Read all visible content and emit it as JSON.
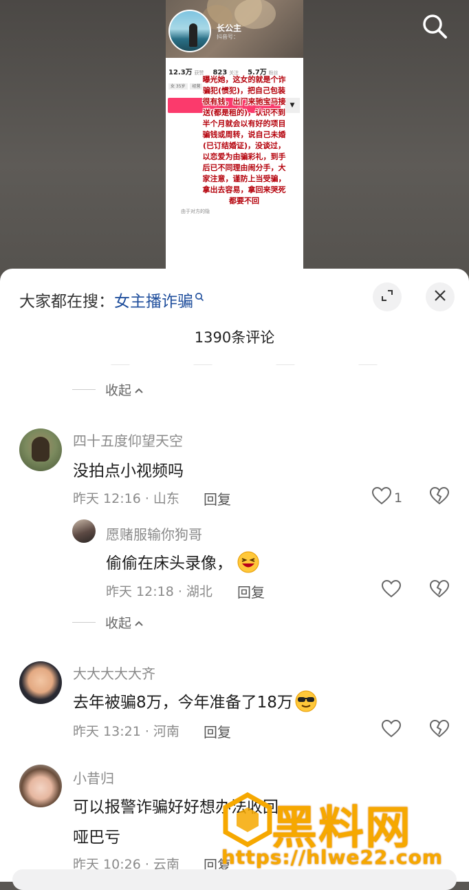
{
  "video": {
    "poster": {
      "name": "长公主",
      "subtitle": "抖音号：",
      "stats": [
        {
          "value": "12.3万",
          "label": "获赞"
        },
        {
          "value": "823",
          "label": "关注"
        },
        {
          "value": "5.7万",
          "label": "粉丝"
        }
      ],
      "tags": [
        "女 35岁",
        "经营"
      ],
      "note": "由于对方的隐"
    },
    "overlay_text": "曝光她，这女的就是个诈骗犯(惯犯)，把自己包装很有钱，出门来驰宝马接送(都是租的)，认识不到半个月就会以有好的项目骗钱或周转，说自己未婚(已订结婚证)，没谈过，以恋爱为由骗彩礼，到手后已不同理由闹分手，大家注意，谨防上当受骗，拿出去容易，拿回来哭死都要不回"
  },
  "sheet": {
    "search_prefix": "大家都在搜：",
    "search_keyword": "女主播诈骗",
    "comment_count": "1390条评论",
    "collapse_label": "收起",
    "reply_label": "回复"
  },
  "comments": [
    {
      "user": "四十五度仰望天空",
      "text": "没拍点小视频吗",
      "time_loc": "昨天 12:16 · 山东",
      "likes": "1",
      "reply": {
        "user": "愿赌服输你狗哥",
        "text": "偷偷在床头录像，",
        "time_loc": "昨天 12:18 · 湖北"
      }
    },
    {
      "user": "大大大大大齐",
      "text": "去年被骗8万，今年准备了18万",
      "time_loc": "昨天 13:21 · 河南"
    },
    {
      "user": "小昔归",
      "text_line1": "可以报警诈骗好好想办法收回",
      "text_line2": "哑巴亏",
      "time_loc": "昨天 10:26 · 云南"
    }
  ],
  "watermark": {
    "text": "黑料网",
    "url": "https://hlwe22.com"
  }
}
